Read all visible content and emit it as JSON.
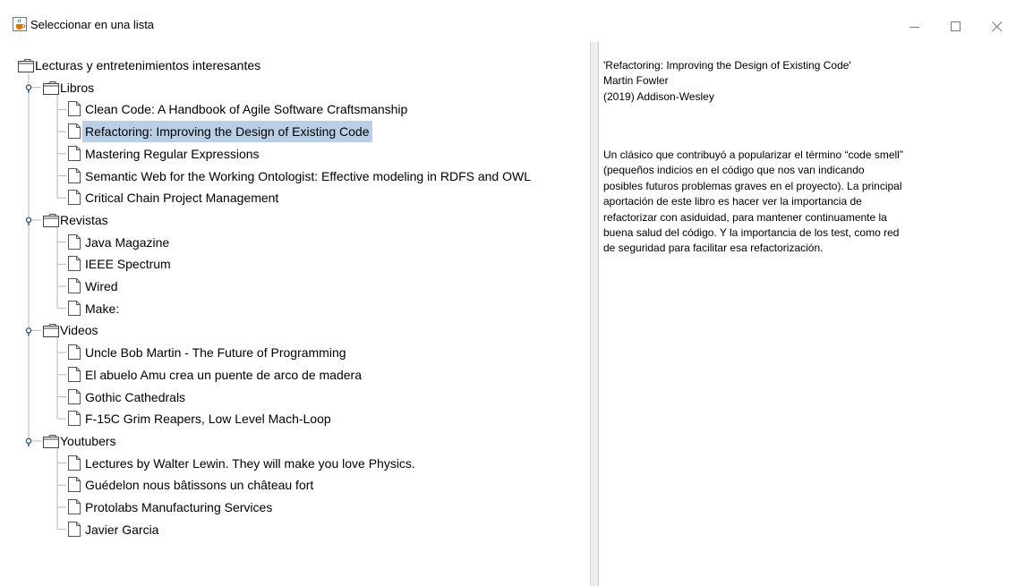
{
  "window": {
    "title": "Seleccionar en una lista",
    "app_icon": "java-cup-icon",
    "controls": [
      "minimize-icon",
      "maximize-icon",
      "close-icon"
    ]
  },
  "tree": {
    "root": "Lecturas y entretenimientos interesantes",
    "selected": "Refactoring: Improving the Design of Existing Code",
    "categories": [
      {
        "label": "Libros",
        "items": [
          "Clean Code: A Handbook of Agile Software Craftsmanship",
          "Refactoring: Improving the Design of Existing Code",
          "Mastering Regular Expressions",
          "Semantic Web for the Working Ontologist: Effective modeling in RDFS and OWL",
          "Critical Chain Project Management"
        ]
      },
      {
        "label": "Revistas",
        "items": [
          "Java Magazine",
          "IEEE Spectrum",
          "Wired",
          "Make:"
        ]
      },
      {
        "label": "Videos",
        "items": [
          "Uncle Bob Martin - The Future of Programming",
          "El abuelo Amu crea un puente de arco de madera",
          "Gothic Cathedrals",
          "F-15C Grim Reapers, Low Level Mach-Loop"
        ]
      },
      {
        "label": "Youtubers",
        "items": [
          "Lectures by Walter Lewin. They will make you love Physics.",
          "Guédelon nous bâtissons un château fort",
          "Protolabs Manufacturing Services",
          "Javier Garcia"
        ]
      }
    ]
  },
  "detail": {
    "header_lines": [
      "'Refactoring: Improving the Design of Existing Code'",
      "Martin Fowler",
      "(2019) Addison-Wesley"
    ],
    "body_lines": [
      " Un clásico que contribuyó a popularizar el término “code smell”",
      "(pequeños indicios en el código que nos van indicando",
      "posibles futuros problemas graves en el proyecto). La principal",
      "aportación de este libro es hacer ver la importancia de",
      "refactorizar con asiduidad, para mantener continuamente la",
      "buena salud del código. Y la importancia de los test, como red",
      "de seguridad para facilitar esa refactorización."
    ]
  },
  "colors": {
    "selection": "#b8cfe5",
    "tree_line": "#b0b8c4",
    "toggle": "#2f5e8c",
    "divider": "#eeeeee"
  }
}
